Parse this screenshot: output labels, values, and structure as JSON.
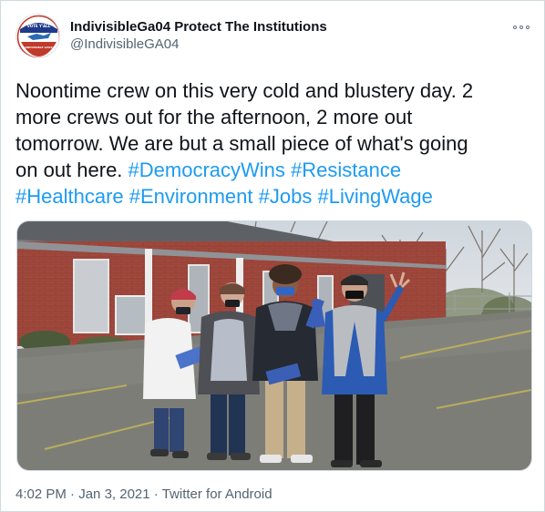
{
  "author": {
    "display_name": "IndivisibleGa04 Protect The Institutions",
    "handle": "@IndivisibleGA04",
    "avatar_icon": "vote-yall-logo-icon",
    "avatar_text_top": "VOTE Y'ALL",
    "avatar_text_bottom": "INDIVISIBLE GA04"
  },
  "tweet": {
    "line1": "Noontime crew on this very cold and blustery day. 2",
    "line2": "more crews out for the afternoon, 2 more out",
    "line3": "tomorrow. We are but a small piece of what's going",
    "line4_text": "on out here. ",
    "hashtags_line4": [
      "#DemocracyWins",
      "#Resistance"
    ],
    "hashtags_line5": [
      "#Healthcare",
      "#Environment",
      "#Jobs",
      "#LivingWage"
    ]
  },
  "media": {
    "photo_icon": "group-photo-icon"
  },
  "meta": {
    "time": "4:02 PM",
    "separator": " · ",
    "date": "Jan 3, 2021",
    "source": "Twitter for Android"
  },
  "colors": {
    "text": "#0f1419",
    "secondary": "#536471",
    "link": "#1d9bf0",
    "border": "#cfd9de"
  }
}
